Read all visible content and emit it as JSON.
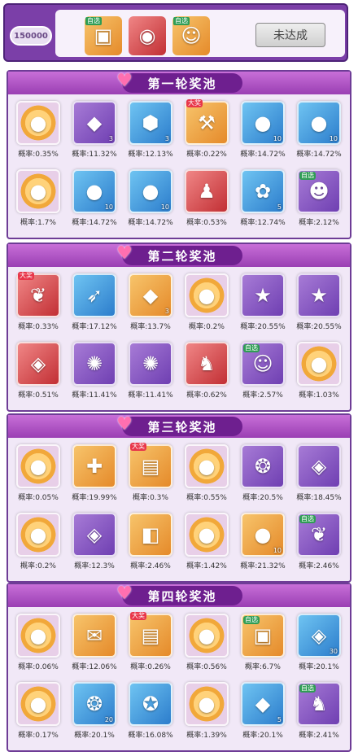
{
  "header": {
    "token": "150000",
    "items": [
      {
        "icon": "chest-icon",
        "flag": "自选"
      },
      {
        "icon": "orb-icon",
        "flag": ""
      },
      {
        "icon": "character-icon",
        "flag": "自选"
      }
    ],
    "button_label": "未达成"
  },
  "pools": [
    {
      "title": "第一轮奖池",
      "items": [
        {
          "icon": "coin-icon",
          "bg": "coin",
          "tag": "",
          "qty": "",
          "prob": "概率:0.35%"
        },
        {
          "icon": "gem-icon",
          "bg": "purple",
          "tag": "",
          "qty": "3",
          "prob": "概率:11.32%"
        },
        {
          "icon": "shield-icon",
          "bg": "blue",
          "tag": "",
          "qty": "3",
          "prob": "概率:12.13%"
        },
        {
          "icon": "excavator-icon",
          "bg": "orange",
          "tag": "大奖",
          "qty": "",
          "prob": "概率:0.22%"
        },
        {
          "icon": "fruit-icon",
          "bg": "blue",
          "tag": "",
          "qty": "10",
          "prob": "概率:14.72%"
        },
        {
          "icon": "fruit-icon",
          "bg": "blue",
          "tag": "",
          "qty": "10",
          "prob": "概率:14.72%"
        },
        {
          "icon": "coin-icon",
          "bg": "coin",
          "tag": "",
          "qty": "",
          "prob": "概率:1.7%"
        },
        {
          "icon": "fruit-icon",
          "bg": "blue",
          "tag": "",
          "qty": "10",
          "prob": "概率:14.72%"
        },
        {
          "icon": "fruit-icon",
          "bg": "blue",
          "tag": "",
          "qty": "10",
          "prob": "概率:14.72%"
        },
        {
          "icon": "silhouette-icon",
          "bg": "red",
          "tag": "",
          "qty": "",
          "prob": "概率:0.53%"
        },
        {
          "icon": "petals-icon",
          "bg": "blue",
          "tag": "",
          "qty": "5",
          "prob": "概率:12.74%"
        },
        {
          "icon": "robot-icon",
          "bg": "purple",
          "tag": "自选",
          "qty": "",
          "prob": "概率:2.12%"
        }
      ]
    },
    {
      "title": "第二轮奖池",
      "items": [
        {
          "icon": "pet-icon",
          "bg": "red",
          "tag": "大奖",
          "qty": "",
          "prob": "概率:0.33%"
        },
        {
          "icon": "wing-icon",
          "bg": "blue",
          "tag": "",
          "qty": "",
          "prob": "概率:17.12%"
        },
        {
          "icon": "gem-icon",
          "bg": "orange",
          "tag": "",
          "qty": "3",
          "prob": "概率:13.7%"
        },
        {
          "icon": "coin-icon",
          "bg": "coin",
          "tag": "",
          "qty": "",
          "prob": "概率:0.2%"
        },
        {
          "icon": "badge-icon",
          "bg": "purple",
          "tag": "",
          "qty": "",
          "prob": "概率:20.55%"
        },
        {
          "icon": "badge-icon",
          "bg": "purple",
          "tag": "",
          "qty": "",
          "prob": "概率:20.55%"
        },
        {
          "icon": "crystal-icon",
          "bg": "red",
          "tag": "",
          "qty": "",
          "prob": "概率:0.51%"
        },
        {
          "icon": "gear-icon",
          "bg": "purple",
          "tag": "",
          "qty": "",
          "prob": "概率:11.41%"
        },
        {
          "icon": "gear-icon",
          "bg": "purple",
          "tag": "",
          "qty": "",
          "prob": "概率:11.41%"
        },
        {
          "icon": "monster-icon",
          "bg": "red",
          "tag": "",
          "qty": "",
          "prob": "概率:0.62%"
        },
        {
          "icon": "character-icon",
          "bg": "purple",
          "tag": "自选",
          "qty": "",
          "prob": "概率:2.57%"
        },
        {
          "icon": "coin-icon",
          "bg": "coin",
          "tag": "",
          "qty": "",
          "prob": "概率:1.03%"
        }
      ]
    },
    {
      "title": "第三轮奖池",
      "items": [
        {
          "icon": "coin-icon",
          "bg": "coin",
          "tag": "",
          "qty": "",
          "prob": "概率:0.05%"
        },
        {
          "icon": "puzzle-icon",
          "bg": "orange",
          "tag": "",
          "qty": "",
          "prob": "概率:19.99%"
        },
        {
          "icon": "card-icon",
          "bg": "orange",
          "tag": "大奖",
          "qty": "",
          "prob": "概率:0.3%"
        },
        {
          "icon": "coin-icon",
          "bg": "coin",
          "tag": "",
          "qty": "",
          "prob": "概率:0.55%"
        },
        {
          "icon": "token-icon",
          "bg": "purple",
          "tag": "",
          "qty": "",
          "prob": "概率:20.5%"
        },
        {
          "icon": "crystal-icon",
          "bg": "purple",
          "tag": "",
          "qty": "",
          "prob": "概率:18.45%"
        },
        {
          "icon": "coin-icon",
          "bg": "coin",
          "tag": "",
          "qty": "",
          "prob": "概率:0.2%"
        },
        {
          "icon": "crystal-icon",
          "bg": "purple",
          "tag": "",
          "qty": "",
          "prob": "概率:12.3%"
        },
        {
          "icon": "cube-icon",
          "bg": "orange",
          "tag": "",
          "qty": "",
          "prob": "概率:2.46%"
        },
        {
          "icon": "coin-icon",
          "bg": "coin",
          "tag": "",
          "qty": "",
          "prob": "概率:1.42%"
        },
        {
          "icon": "fruit-icon",
          "bg": "orange",
          "tag": "",
          "qty": "10",
          "prob": "概率:21.32%"
        },
        {
          "icon": "pet-icon",
          "bg": "purple",
          "tag": "自选",
          "qty": "",
          "prob": "概率:2.46%"
        }
      ]
    },
    {
      "title": "第四轮奖池",
      "items": [
        {
          "icon": "coin-icon",
          "bg": "coin",
          "tag": "",
          "qty": "",
          "prob": "概率:0.06%"
        },
        {
          "icon": "scroll-icon",
          "bg": "orange",
          "tag": "",
          "qty": "",
          "prob": "概率:12.06%"
        },
        {
          "icon": "card-icon",
          "bg": "orange",
          "tag": "大奖",
          "qty": "",
          "prob": "概率:0.26%"
        },
        {
          "icon": "coin-icon",
          "bg": "coin",
          "tag": "",
          "qty": "",
          "prob": "概率:0.56%"
        },
        {
          "icon": "chest-icon",
          "bg": "orange",
          "tag": "自选",
          "qty": "",
          "prob": "概率:6.7%"
        },
        {
          "icon": "crystal-icon",
          "bg": "blue",
          "tag": "",
          "qty": "30",
          "prob": "概率:20.1%"
        },
        {
          "icon": "coin-icon",
          "bg": "coin",
          "tag": "",
          "qty": "",
          "prob": "概率:0.17%"
        },
        {
          "icon": "token-icon",
          "bg": "blue",
          "tag": "",
          "qty": "20",
          "prob": "概率:20.1%"
        },
        {
          "icon": "amulet-icon",
          "bg": "blue",
          "tag": "",
          "qty": "",
          "prob": "概率:16.08%"
        },
        {
          "icon": "coin-icon",
          "bg": "coin",
          "tag": "",
          "qty": "",
          "prob": "概率:1.39%"
        },
        {
          "icon": "gem-icon",
          "bg": "blue",
          "tag": "",
          "qty": "5",
          "prob": "概率:20.1%"
        },
        {
          "icon": "monster-icon",
          "bg": "purple",
          "tag": "自选",
          "qty": "",
          "prob": "概率:2.41%"
        }
      ]
    }
  ]
}
